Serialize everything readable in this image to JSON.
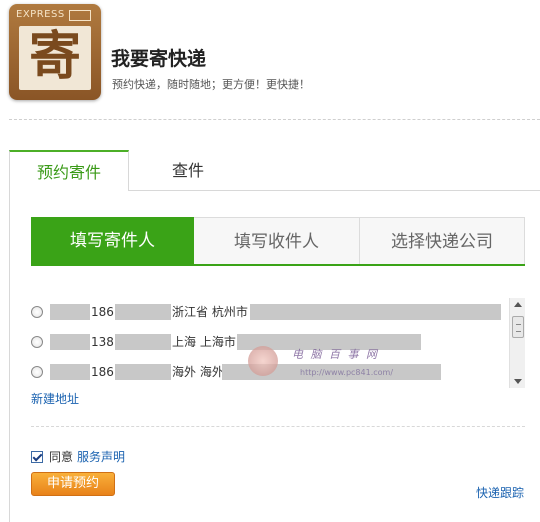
{
  "logo": {
    "top_text": "EXPRESS",
    "char": "寄"
  },
  "header": {
    "title": "我要寄快递",
    "subtitle": "预约快递，随时随地；更方便！更快捷！"
  },
  "tabs": [
    {
      "label": "预约寄件",
      "active": true
    },
    {
      "label": "查件",
      "active": false
    }
  ],
  "steps": [
    {
      "label": "填写寄件人",
      "active": true
    },
    {
      "label": "填写收件人",
      "active": false
    },
    {
      "label": "选择快递公司",
      "active": false
    }
  ],
  "addresses": [
    {
      "phone_prefix": "186",
      "location": "浙江省 杭州市"
    },
    {
      "phone_prefix": "138",
      "location": "上海 上海市"
    },
    {
      "phone_prefix": "186",
      "location": "海外 海外"
    }
  ],
  "new_address_link": "新建地址",
  "agreement": {
    "checked": true,
    "label": "同意",
    "link": "服务声明"
  },
  "submit_button": "申请预约",
  "track_link": "快递跟踪",
  "watermark": {
    "title": "电 脑 百 事 网",
    "url": "http://www.pc841.com/"
  },
  "colors": {
    "accent_green": "#3aa317",
    "link_blue": "#1a62b0",
    "button_orange": "#f0962a",
    "logo_brown": "#9c6530"
  }
}
